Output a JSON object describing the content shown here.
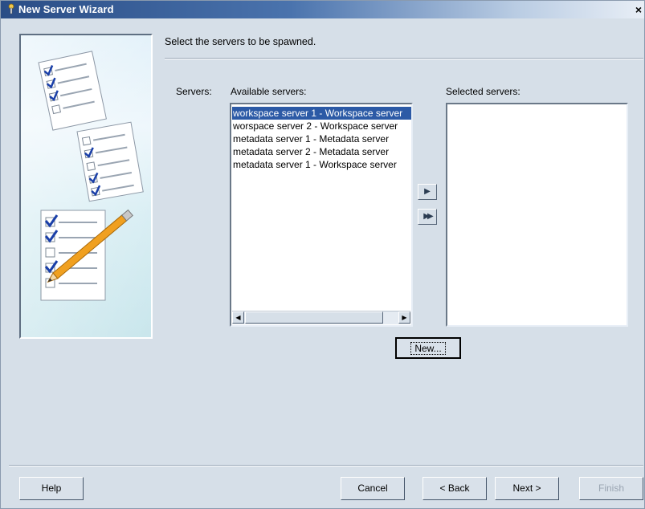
{
  "window": {
    "title": "New Server Wizard",
    "close_glyph": "×"
  },
  "instruction": "Select the servers to be spawned.",
  "servers_label": "Servers:",
  "available": {
    "label": "Available servers:",
    "items": [
      {
        "text": "workspace server 1 - Workspace server",
        "selected": true
      },
      {
        "text": "worspace server 2 - Workspace server",
        "selected": false
      },
      {
        "text": "metadata server 1 - Metadata server",
        "selected": false
      },
      {
        "text": "metadata server 2 - Metadata server",
        "selected": false
      },
      {
        "text": "metadata server 1 - Workspace server",
        "selected": false
      }
    ]
  },
  "selected": {
    "label": "Selected servers:",
    "items": []
  },
  "arrows": {
    "add": "▶",
    "add_all": "▶▶"
  },
  "buttons": {
    "new": "New...",
    "help": "Help",
    "cancel": "Cancel",
    "back": "< Back",
    "next": "Next >",
    "finish": "Finish"
  },
  "colors": {
    "selection": "#2c5aa6",
    "checkmark": "#1a3fa8",
    "pencil": "#f0a020"
  }
}
